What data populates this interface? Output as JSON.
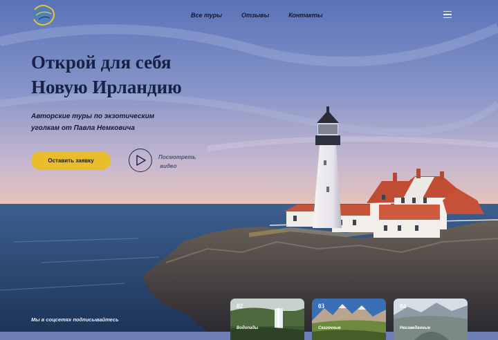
{
  "nav": {
    "items": [
      "Все туры",
      "Отзывы",
      "Контакты"
    ]
  },
  "hero": {
    "title_line1": "Открой для себя",
    "title_line2": "Новую Ирландию",
    "subtitle_line1": "Авторские туры по экзотическим",
    "subtitle_line2": "уголкам от Павла Немковича",
    "cta_label": "Оставить заявку",
    "video_line1": "Посмотреть",
    "video_line2": "видео"
  },
  "footer": {
    "social_text": "Мы в соцсетях подписывайтесь"
  },
  "cards": [
    {
      "number": "02",
      "label": "Водопады"
    },
    {
      "number": "03",
      "label": "Сказочные"
    },
    {
      "number": "04",
      "label": "Неизведанные"
    }
  ],
  "colors": {
    "accent": "#e9bd2c",
    "title": "#182046",
    "sky_top": "#5a73b6",
    "sea": "#2e4a78"
  },
  "icons": [
    "logo-icon",
    "menu-icon",
    "play-icon"
  ]
}
